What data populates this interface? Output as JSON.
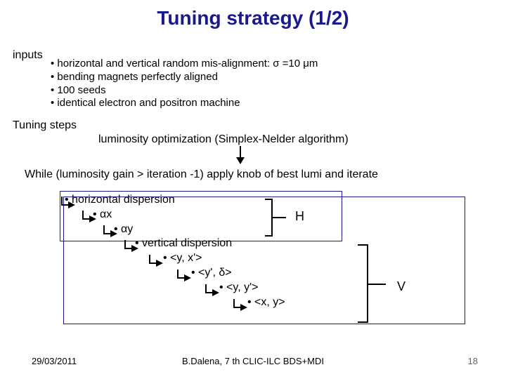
{
  "title": "Tuning strategy (1/2)",
  "inputs_label": "inputs",
  "inputs_items": {
    "i0": "horizontal and vertical random mis-alignment: σ =10 μm",
    "i1": "bending magnets perfectly aligned",
    "i2": "100 seeds",
    "i3": "identical electron and positron machine"
  },
  "tuning_steps_label": "Tuning steps",
  "lumi_opt": "luminosity optimization (Simplex-Nelder algorithm)",
  "while_line": "While (luminosity gain > iteration -1) apply knob of best lumi and iterate",
  "cascade": {
    "c0": "horizontal dispersion",
    "c1": "αx",
    "c2": "αy",
    "c3": "vertical  dispersion",
    "c4": "<y, x'>",
    "c5": "<y', δ>",
    "c6": "<y, y'>",
    "c7": "<x, y>"
  },
  "H_label": "H",
  "V_label": "V",
  "footer": {
    "date": "29/03/2011",
    "center": "B.Dalena, 7 th CLIC-ILC BDS+MDI",
    "page": "18"
  }
}
